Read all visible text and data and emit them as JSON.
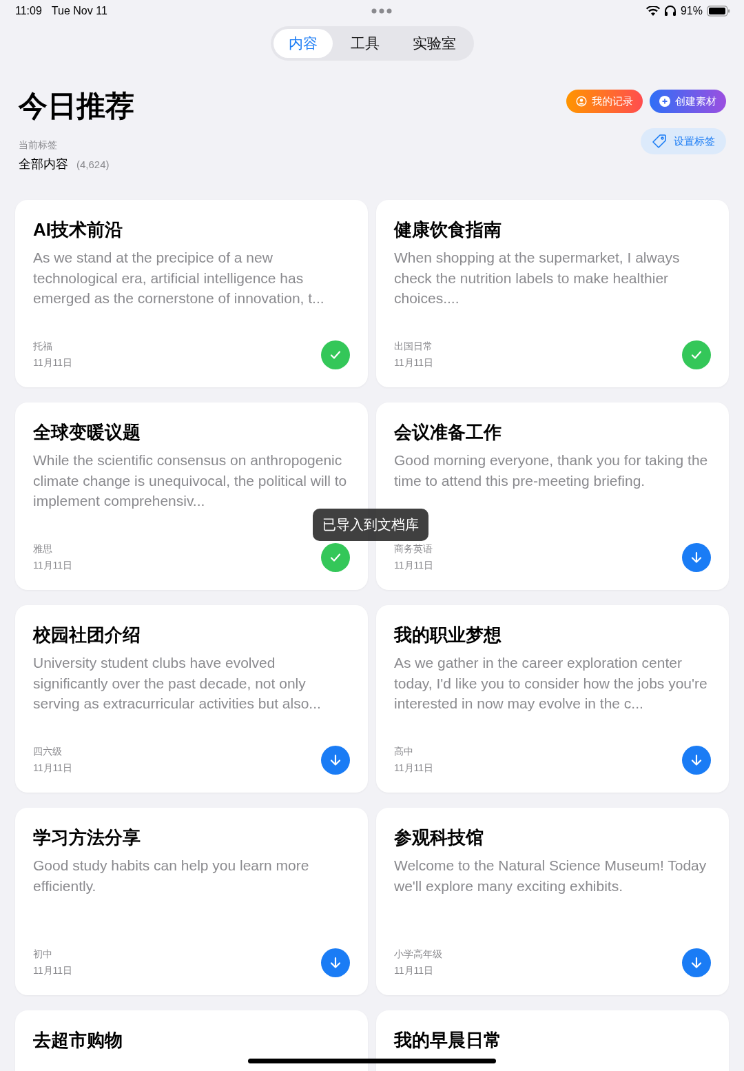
{
  "status_bar": {
    "time": "11:09",
    "date": "Tue Nov 11",
    "battery": "91%"
  },
  "tabs": [
    {
      "label": "内容",
      "selected": true
    },
    {
      "label": "工具",
      "selected": false
    },
    {
      "label": "实验室",
      "selected": false
    }
  ],
  "header": {
    "title": "今日推荐",
    "tag_caption": "当前标签",
    "tag_name": "全部内容",
    "tag_count": "(4,624)"
  },
  "buttons": {
    "records": "我的记录",
    "create": "创建素材",
    "set_tags": "设置标签"
  },
  "cards": [
    {
      "title": "AI技术前沿",
      "body": "As we stand at the precipice of a new technological era, artificial intelligence has emerged as the cornerstone of innovation, t...",
      "tag": "托福",
      "date": "11月11日",
      "kind": "done"
    },
    {
      "title": "健康饮食指南",
      "body": "When shopping at the supermarket, I always check the nutrition labels to make healthier choices....",
      "tag": "出国日常",
      "date": "11月11日",
      "kind": "done"
    },
    {
      "title": "全球变暖议题",
      "body": "While the scientific consensus on anthropogenic climate change is unequivocal, the political will to implement comprehensiv...",
      "tag": "雅思",
      "date": "11月11日",
      "kind": "done"
    },
    {
      "title": "会议准备工作",
      "body": "Good morning everyone, thank you for taking the time to attend this pre-meeting briefing.",
      "tag": "商务英语",
      "date": "11月11日",
      "kind": "download"
    },
    {
      "title": "校园社团介绍",
      "body": "University student clubs have evolved significantly over the past decade, not only serving as extracurricular activities but also...",
      "tag": "四六级",
      "date": "11月11日",
      "kind": "download"
    },
    {
      "title": "我的职业梦想",
      "body": "As we gather in the career exploration center today, I'd like you to consider how the jobs you're interested in now may evolve in the c...",
      "tag": "高中",
      "date": "11月11日",
      "kind": "download"
    },
    {
      "title": "学习方法分享",
      "body": "Good study habits can help you learn more efficiently.",
      "tag": "初中",
      "date": "11月11日",
      "kind": "download"
    },
    {
      "title": "参观科技馆",
      "body": "Welcome to the Natural Science Museum! Today we'll explore many exciting exhibits.",
      "tag": "小学高年级",
      "date": "11月11日",
      "kind": "download"
    },
    {
      "title": "去超市购物"
    },
    {
      "title": "我的早晨日常"
    }
  ],
  "toast": "已导入到文档库"
}
